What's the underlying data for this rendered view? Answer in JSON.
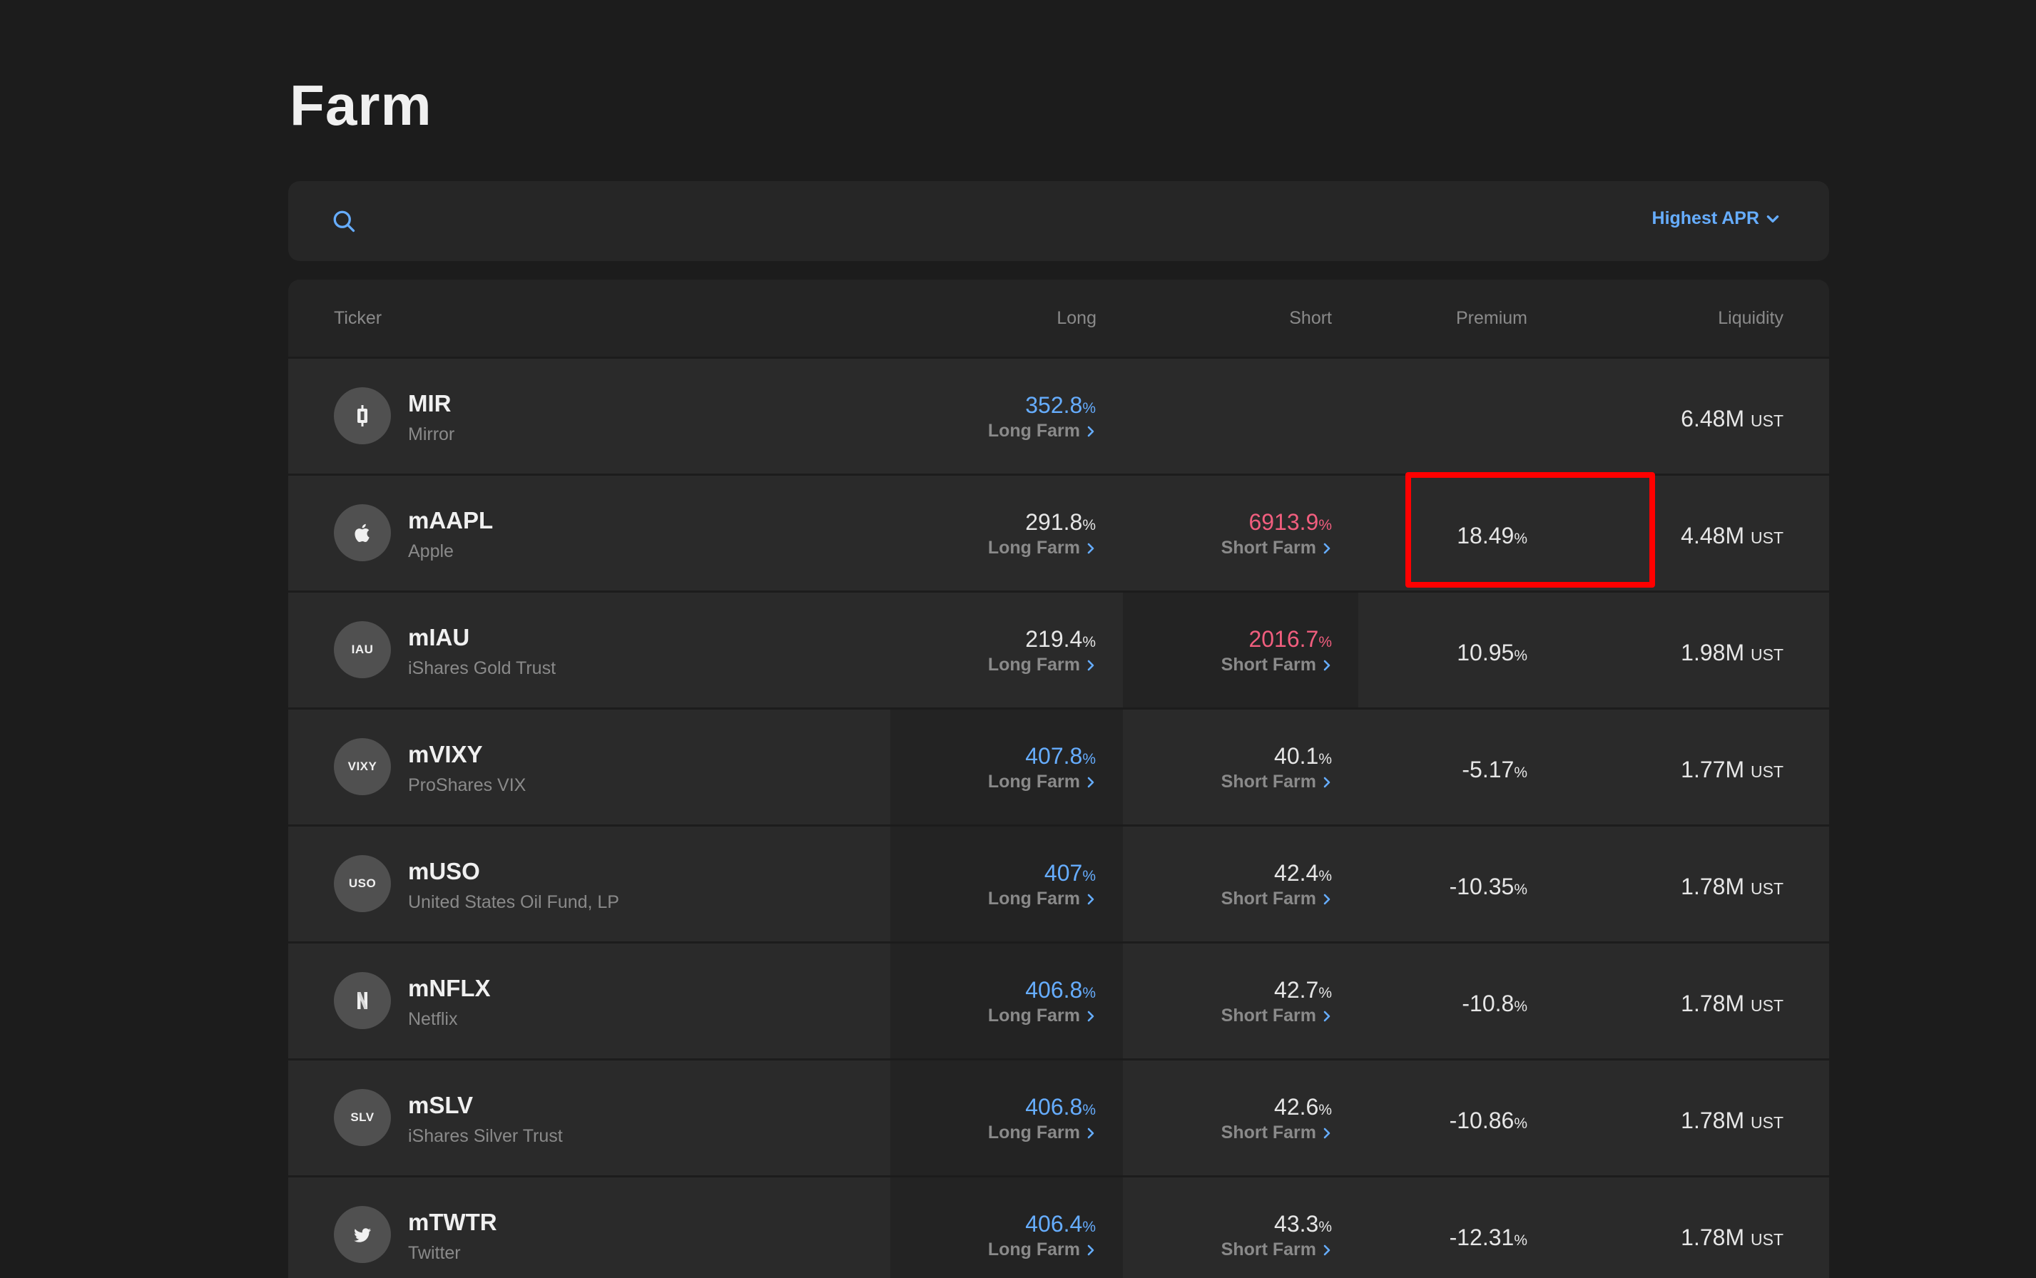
{
  "page": {
    "title": "Farm"
  },
  "search": {
    "placeholder": ""
  },
  "sort": {
    "label": "Highest APR"
  },
  "table": {
    "headers": {
      "ticker": "Ticker",
      "long": "Long",
      "short": "Short",
      "premium": "Premium",
      "liquidity": "Liquidity"
    },
    "long_link_label": "Long Farm",
    "short_link_label": "Short Farm",
    "pct_symbol": "%",
    "liquidity_unit": "UST",
    "rows": [
      {
        "symbol": "MIR",
        "name": "Mirror",
        "icon": "mirror-logo-icon",
        "icon_text": "",
        "long_apr": "352.8",
        "short_apr": "",
        "premium": "",
        "liquidity": "6.48M"
      },
      {
        "symbol": "mAAPL",
        "name": "Apple",
        "icon": "apple-logo-icon",
        "icon_text": "",
        "long_apr": "291.8",
        "short_apr": "6913.9",
        "premium": "18.49",
        "liquidity": "4.48M"
      },
      {
        "symbol": "mIAU",
        "name": "iShares Gold Trust",
        "icon": "iau-text-icon",
        "icon_text": "IAU",
        "long_apr": "219.4",
        "short_apr": "2016.7",
        "premium": "10.95",
        "liquidity": "1.98M"
      },
      {
        "symbol": "mVIXY",
        "name": "ProShares VIX",
        "icon": "vixy-text-icon",
        "icon_text": "VIXY",
        "long_apr": "407.8",
        "short_apr": "40.1",
        "premium": "-5.17",
        "liquidity": "1.77M"
      },
      {
        "symbol": "mUSO",
        "name": "United States Oil Fund, LP",
        "icon": "uso-text-icon",
        "icon_text": "USO",
        "long_apr": "407",
        "short_apr": "42.4",
        "premium": "-10.35",
        "liquidity": "1.78M"
      },
      {
        "symbol": "mNFLX",
        "name": "Netflix",
        "icon": "netflix-logo-icon",
        "icon_text": "",
        "long_apr": "406.8",
        "short_apr": "42.7",
        "premium": "-10.8",
        "liquidity": "1.78M"
      },
      {
        "symbol": "mSLV",
        "name": "iShares Silver Trust",
        "icon": "slv-text-icon",
        "icon_text": "SLV",
        "long_apr": "406.8",
        "short_apr": "42.6",
        "premium": "-10.86",
        "liquidity": "1.78M"
      },
      {
        "symbol": "mTWTR",
        "name": "Twitter",
        "icon": "twitter-logo-icon",
        "icon_text": "",
        "long_apr": "406.4",
        "short_apr": "43.3",
        "premium": "-12.31",
        "liquidity": "1.78M"
      }
    ]
  },
  "colors": {
    "accent_blue": "#66adff",
    "short_red": "#f15e7e",
    "highlight": "#ff0000"
  }
}
